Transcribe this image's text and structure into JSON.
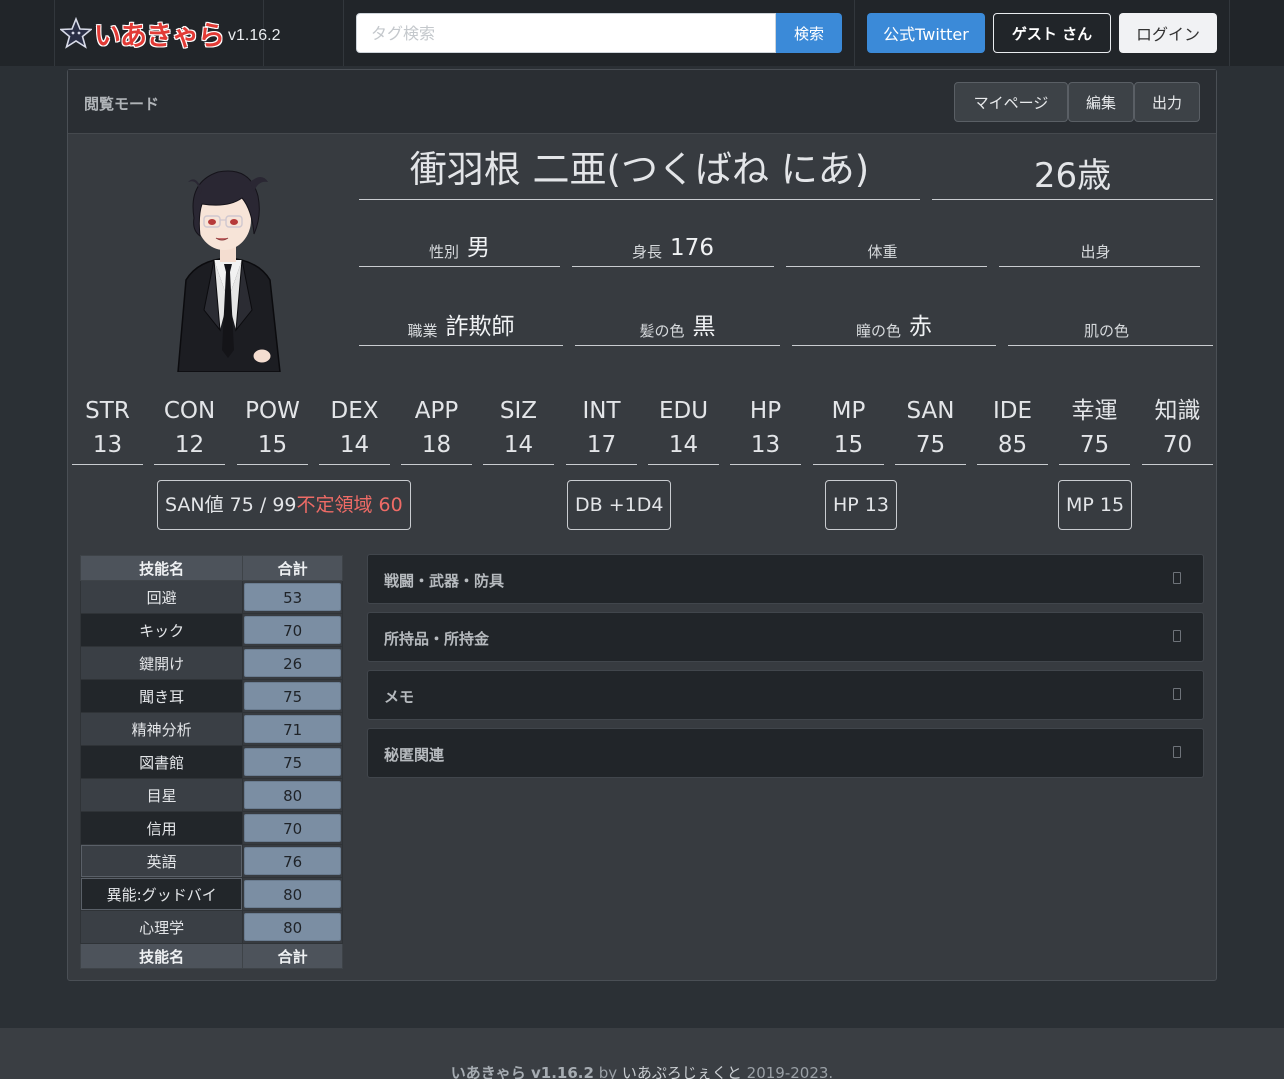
{
  "nav": {
    "version": "v1.16.2",
    "search_placeholder": "タグ検索",
    "search_button": "検索",
    "twitter_button": "公式Twitter",
    "guest_button": "ゲスト さん",
    "login_button": "ログイン"
  },
  "card": {
    "mode": "閲覧モード",
    "buttons": {
      "mypage": "マイページ",
      "edit": "編集",
      "export": "出力"
    }
  },
  "character": {
    "name": "衝羽根 二亜(つくばね にあ)",
    "age": "26歳",
    "attributes": [
      {
        "label": "性別",
        "value": "男"
      },
      {
        "label": "身長",
        "value": "176"
      },
      {
        "label": "体重",
        "value": ""
      },
      {
        "label": "出身",
        "value": ""
      },
      {
        "label": "職業",
        "value": "詐欺師"
      },
      {
        "label": "髪の色",
        "value": "黒"
      },
      {
        "label": "瞳の色",
        "value": "赤"
      },
      {
        "label": "肌の色",
        "value": ""
      }
    ]
  },
  "stats": [
    {
      "label": "STR",
      "value": "13"
    },
    {
      "label": "CON",
      "value": "12"
    },
    {
      "label": "POW",
      "value": "15"
    },
    {
      "label": "DEX",
      "value": "14"
    },
    {
      "label": "APP",
      "value": "18"
    },
    {
      "label": "SIZ",
      "value": "14"
    },
    {
      "label": "INT",
      "value": "17"
    },
    {
      "label": "EDU",
      "value": "14"
    },
    {
      "label": "HP",
      "value": "13"
    },
    {
      "label": "MP",
      "value": "15"
    },
    {
      "label": "SAN",
      "value": "75"
    },
    {
      "label": "IDE",
      "value": "85"
    },
    {
      "label": "幸運",
      "value": "75"
    },
    {
      "label": "知識",
      "value": "70"
    }
  ],
  "derived": {
    "san": "SAN値 75 / 99",
    "san_unstable": "不定領域 60",
    "db": "DB +1D4",
    "hp": "HP 13",
    "mp": "MP 15"
  },
  "skills": {
    "header_name": "技能名",
    "header_total": "合計",
    "rows": [
      {
        "name": "回避",
        "total": "53"
      },
      {
        "name": "キック",
        "total": "70"
      },
      {
        "name": "鍵開け",
        "total": "26"
      },
      {
        "name": "聞き耳",
        "total": "75"
      },
      {
        "name": "精神分析",
        "total": "71"
      },
      {
        "name": "図書館",
        "total": "75"
      },
      {
        "name": "目星",
        "total": "80"
      },
      {
        "name": "信用",
        "total": "70"
      },
      {
        "name": "英語",
        "total": "76"
      },
      {
        "name": "異能:グッドバイ",
        "total": "80"
      },
      {
        "name": "心理学",
        "total": "80"
      }
    ]
  },
  "sections": [
    "戦闘・武器・防具",
    "所持品・所持金",
    "メモ",
    "秘匿関連"
  ],
  "footer": {
    "app": "いあきゃら v1.16.2",
    "by": " by ",
    "author": "いあぷろじぇくと",
    "years": " 2019-2023."
  }
}
